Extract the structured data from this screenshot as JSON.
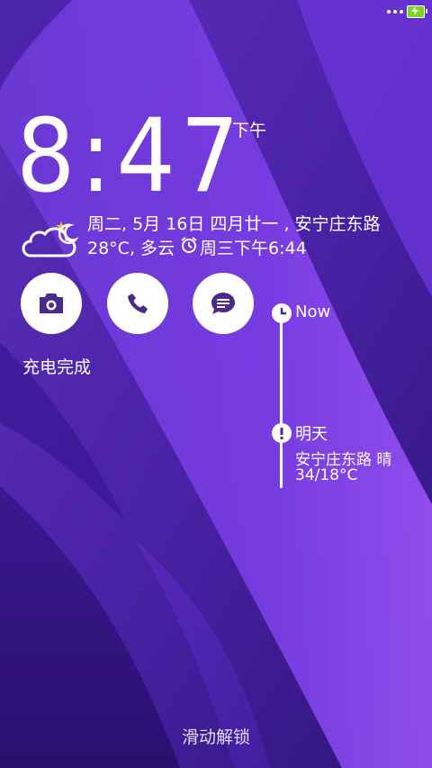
{
  "status_bar": {
    "overflow_icon": "more-dots-icon",
    "battery_icon": "battery-charging-icon",
    "battery_color": "#7ed321"
  },
  "clock": {
    "time": "8:47",
    "ampm": "下午"
  },
  "info": {
    "date": "周二, 5月 16日 四月廿一 , 安宁庄东路",
    "temperature_condition": "28°C, 多云",
    "alarm": "周三下午6:44",
    "weather_icon": "cloudy-night-icon",
    "alarm_icon": "alarm-clock-icon"
  },
  "shortcuts": [
    {
      "name": "camera",
      "icon": "camera-icon"
    },
    {
      "name": "phone",
      "icon": "phone-icon"
    },
    {
      "name": "messages",
      "icon": "message-icon"
    }
  ],
  "charge_status": "充电完成",
  "timeline": {
    "now_label": "Now",
    "tomorrow_label": "明天",
    "tomorrow_weather": "安宁庄东路 晴",
    "tomorrow_temp": "34/18°C"
  },
  "unlock_hint": "滑动解锁",
  "colors": {
    "wallpaper_base": "#4a1fa0",
    "wallpaper_light": "#8a3cf0",
    "shortcut_icon": "#4b2a8c"
  }
}
